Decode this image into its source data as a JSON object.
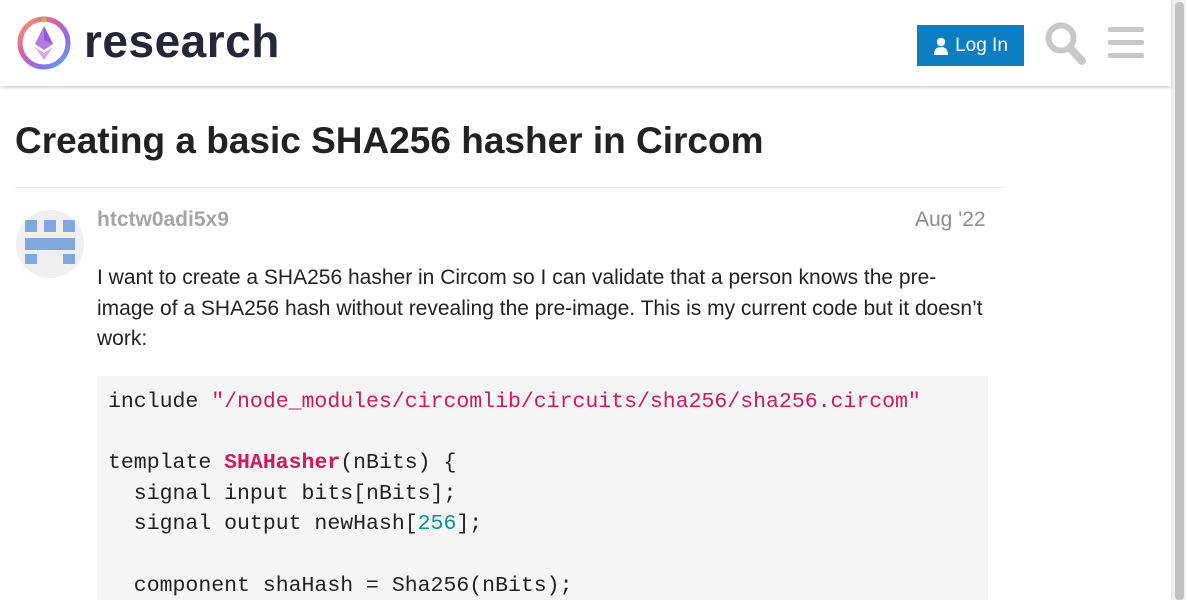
{
  "header": {
    "site_title": "research",
    "login_label": "Log In",
    "icons": {
      "logo": "ethereum-research-logo",
      "user": "user-icon",
      "search": "search-icon",
      "menu": "hamburger-menu-icon"
    },
    "colors": {
      "login_bg": "#0a7ec1",
      "icon_gray": "#c8c8c8"
    }
  },
  "topic": {
    "title": "Creating a basic SHA256 hasher in Circom"
  },
  "post": {
    "username": "htctw0adi5x9",
    "date": "Aug '22",
    "body": "I want to create a SHA256 hasher in Circom so I can validate that a person knows the pre-image of a SHA256 hash without revealing the pre-image. This is my current code but it doesn’t work:",
    "avatar_color": "#7ea9da"
  },
  "code": {
    "line1_kw": "include ",
    "line1_str": "\"/node_modules/circomlib/circuits/sha256/sha256.circom\"",
    "line3_kw": "template ",
    "line3_fn": "SHAHasher",
    "line3_rest": "(nBits) {",
    "line4": "  signal input bits[nBits];",
    "line5_a": "  signal output newHash[",
    "line5_num": "256",
    "line5_b": "];",
    "line7": "  component shaHash = Sha256(nBits);"
  }
}
